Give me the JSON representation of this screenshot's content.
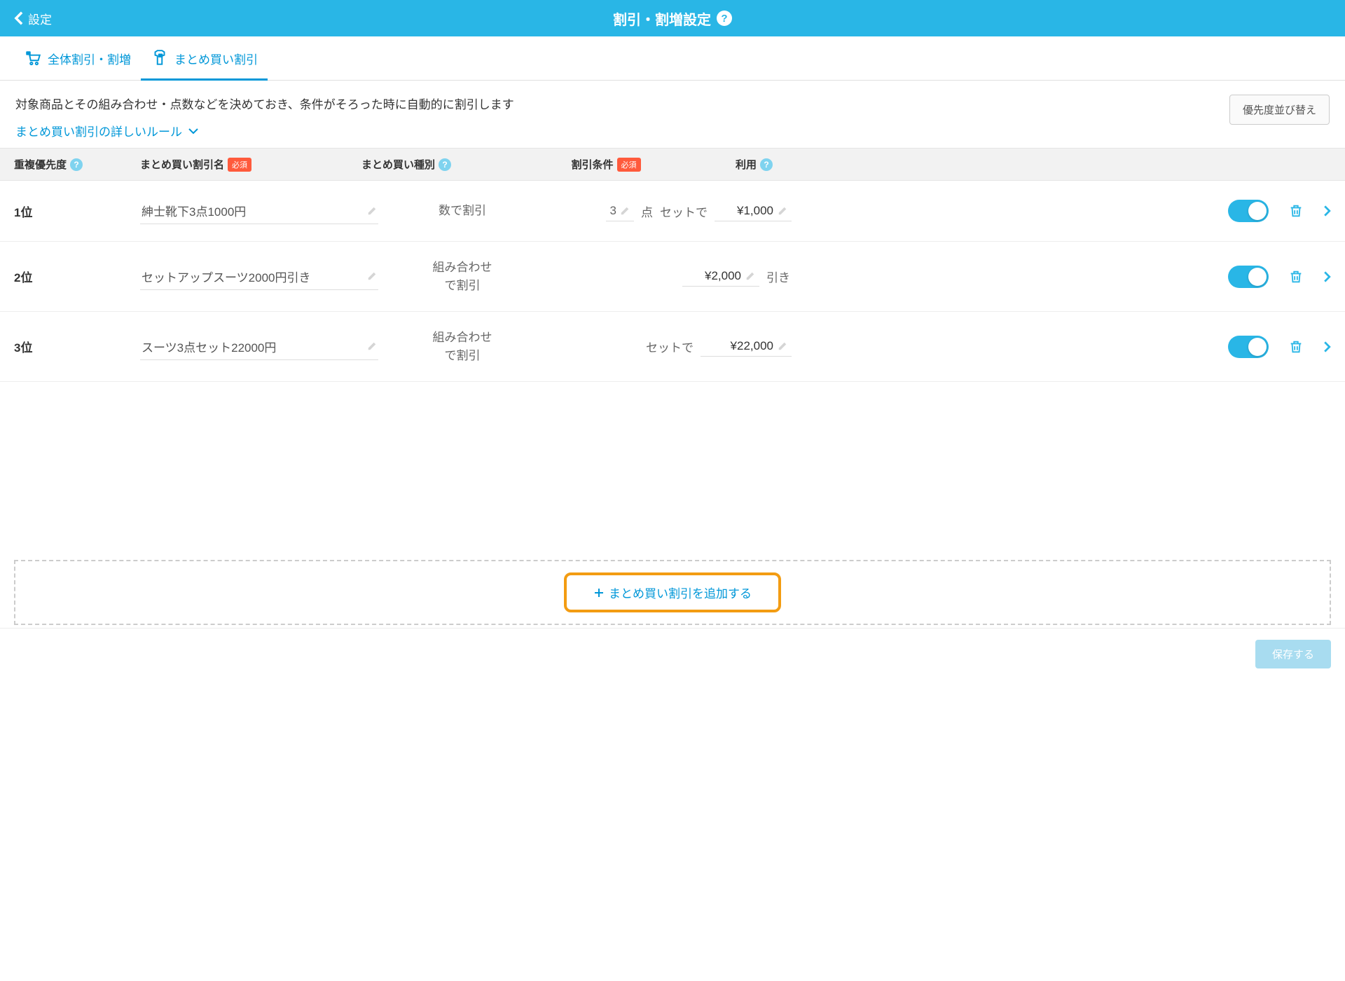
{
  "header": {
    "back_label": "設定",
    "title": "割引・割増設定"
  },
  "tabs": [
    {
      "label": "全体割引・割増",
      "active": false
    },
    {
      "label": "まとめ買い割引",
      "active": true
    }
  ],
  "intro": {
    "description": "対象商品とその組み合わせ・点数などを決めておき、条件がそろった時に自動的に割引します",
    "link_label": "まとめ買い割引の詳しいルール",
    "sort_button": "優先度並び替え"
  },
  "columns": {
    "priority": "重複優先度",
    "name": "まとめ買い割引名",
    "type": "まとめ買い種別",
    "condition": "割引条件",
    "usage": "利用",
    "required_badge": "必須"
  },
  "rows": [
    {
      "priority": "1位",
      "name": "紳士靴下3点1000円",
      "type": "数で割引",
      "qty": "3",
      "unit": "点",
      "suffix": "セットで",
      "price": "¥1,000",
      "after": ""
    },
    {
      "priority": "2位",
      "name": "セットアップスーツ2000円引き",
      "type": "組み合わせ\nで割引",
      "qty": "",
      "unit": "",
      "suffix": "",
      "price": "¥2,000",
      "after": "引き"
    },
    {
      "priority": "3位",
      "name": "スーツ3点セット22000円",
      "type": "組み合わせ\nで割引",
      "qty": "",
      "unit": "",
      "suffix": "セットで",
      "price": "¥22,000",
      "after": ""
    }
  ],
  "add_button": "まとめ買い割引を追加する",
  "save_button": "保存する"
}
